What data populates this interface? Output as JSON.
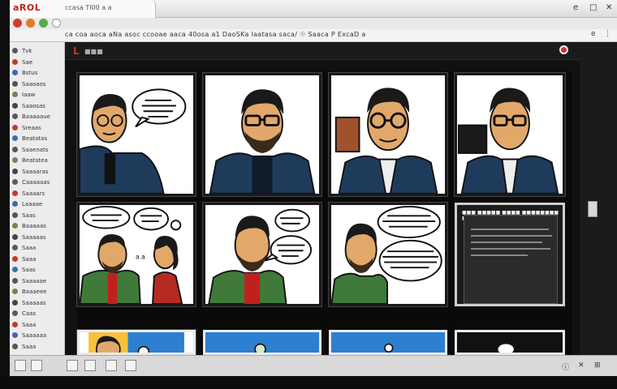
{
  "browser": {
    "tab_title": "aROL",
    "tab_subtitle": "ccasa  TI00  a a",
    "window_controls": [
      "e",
      "□",
      "✕"
    ],
    "url": "ca coa aoca  aNa asoc  ccooae  aaca 40osa a1  DaoSKa  laatasa  saca/ ☉  Saaca P ExcaD  a",
    "address_right": [
      "e",
      "⋮"
    ]
  },
  "sidebar": {
    "items": [
      {
        "label": "Tvk"
      },
      {
        "label": "Sae"
      },
      {
        "label": "Bstus"
      },
      {
        "label": "Saaoaos"
      },
      {
        "label": "Iaaw"
      },
      {
        "label": "Saaosas"
      },
      {
        "label": "Baaaaaue"
      },
      {
        "label": "Sreaas"
      },
      {
        "label": "Beatatas"
      },
      {
        "label": "Saaenats"
      },
      {
        "label": "Beatatea"
      },
      {
        "label": "Saaaaras"
      },
      {
        "label": "Caaaaaas"
      },
      {
        "label": "Saaaars"
      },
      {
        "label": "Laaaae"
      },
      {
        "label": "Saas"
      },
      {
        "label": "Baaaaas"
      },
      {
        "label": "Saaaaas"
      },
      {
        "label": "Saaa"
      },
      {
        "label": "Saaa"
      },
      {
        "label": "Saas"
      },
      {
        "label": "Saaaaae"
      },
      {
        "label": "Baaaeee"
      },
      {
        "label": "Saaaaas"
      },
      {
        "label": "Caas"
      },
      {
        "label": "Saaa"
      },
      {
        "label": "Saaaaaa"
      },
      {
        "label": "Saaa"
      }
    ]
  },
  "viewer": {
    "logo": "L",
    "title": "■■■",
    "dark_panel": {
      "heading": "■■■  ■■■■■ ■■■■ ■■■■■■■■ ■■■"
    }
  },
  "statusbar": {
    "right_icons": [
      "ⓘ",
      "✕",
      "⊞"
    ]
  },
  "colors": {
    "background": "#111111",
    "panel_border": "#1a1a1a",
    "jacket_blue": "#1f3b5c",
    "jacket_green": "#3f7a3a",
    "skin": "#e2a86a",
    "accent_red": "#c0211e"
  }
}
